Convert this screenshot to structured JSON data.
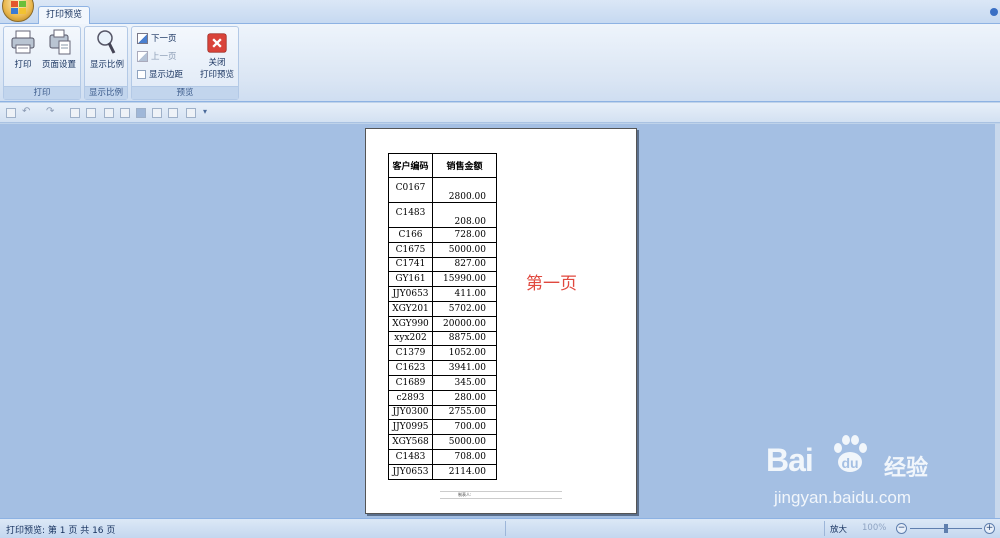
{
  "tabs": {
    "active_tab": "打印预览"
  },
  "ribbon": {
    "print_group": {
      "label": "打印",
      "print_button": "打印",
      "page_setup_button": "页面设置"
    },
    "zoom_group": {
      "label": "显示比例",
      "zoom_button": "显示比例"
    },
    "preview_group": {
      "label": "预览",
      "next_page": "下一页",
      "prev_page": "上一页",
      "show_margins": "显示边距",
      "close_preview_line1": "关闭",
      "close_preview_line2": "打印预览"
    }
  },
  "sheet": {
    "headers": [
      "客户编码",
      "销售金额"
    ],
    "rows": [
      {
        "code": "C0167",
        "amount": "2800.00"
      },
      {
        "code": "C1483",
        "amount": "208.00"
      },
      {
        "code": "C166",
        "amount": "728.00"
      },
      {
        "code": "C1675",
        "amount": "5000.00"
      },
      {
        "code": "C1741",
        "amount": "827.00"
      },
      {
        "code": "GY161",
        "amount": "15990.00"
      },
      {
        "code": "JJY0653",
        "amount": "411.00"
      },
      {
        "code": "XGY201",
        "amount": "5702.00"
      },
      {
        "code": "XGY990",
        "amount": "20000.00"
      },
      {
        "code": "xyx202",
        "amount": "8875.00"
      },
      {
        "code": "C1379",
        "amount": "1052.00"
      },
      {
        "code": "C1623",
        "amount": "3941.00"
      },
      {
        "code": "C1689",
        "amount": "345.00"
      },
      {
        "code": "c2893",
        "amount": "280.00"
      },
      {
        "code": "JJY0300",
        "amount": "2755.00"
      },
      {
        "code": "JJY0995",
        "amount": "700.00"
      },
      {
        "code": "XGY568",
        "amount": "5000.00"
      },
      {
        "code": "C1483",
        "amount": "708.00"
      },
      {
        "code": "JJY0653",
        "amount": "2114.00"
      }
    ],
    "page_note": "第一页",
    "footer_label": "制表人:"
  },
  "watermark": {
    "logo": "Bai",
    "logo_suffix": "经验",
    "url": "jingyan.baidu.com"
  },
  "status": {
    "text": "打印预览: 第 1 页 共 16 页",
    "zoom_in_label": "放大",
    "zoom_percent": "100%",
    "zoom_fraction": 0.5
  },
  "colors": {
    "page_note": "#e0483e",
    "workspace": "#a4bfe3"
  }
}
